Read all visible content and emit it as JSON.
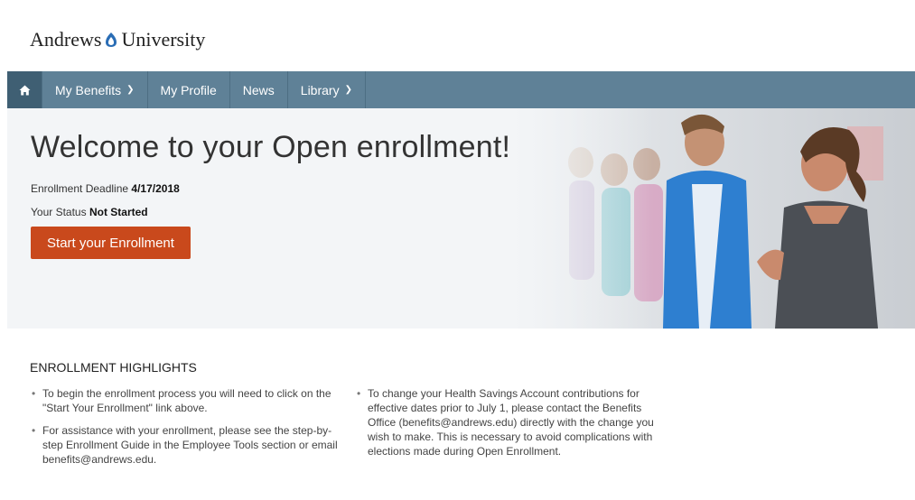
{
  "brand": {
    "name_left": "Andrews",
    "name_right": "University",
    "logo_icon": "flame-icon",
    "accent": "#2a6db5"
  },
  "nav": {
    "home_icon": "home-icon",
    "items": [
      {
        "label": "My Benefits",
        "dropdown": true
      },
      {
        "label": "My Profile",
        "dropdown": false
      },
      {
        "label": "News",
        "dropdown": false
      },
      {
        "label": "Library",
        "dropdown": true
      }
    ],
    "bar_color": "#5f8197",
    "active_color": "#3f5f73"
  },
  "hero": {
    "title": "Welcome to your Open enrollment!",
    "deadline_label": "Enrollment Deadline",
    "deadline_value": "4/17/2018",
    "status_label": "Your Status",
    "status_value": "Not Started",
    "cta_label": "Start your Enrollment",
    "cta_color": "#c9491c"
  },
  "highlights": {
    "title": "ENROLLMENT HIGHLIGHTS",
    "left": [
      "To begin the enrollment process you will need to click on the \"Start Your Enrollment\" link above.",
      "For assistance with your enrollment, please see the step-by-step Enrollment Guide in the Employee Tools section or email benefits@andrews.edu."
    ],
    "right": [
      "To change your Health Savings Account contributions for effective dates prior to July 1, please contact the Benefits Office (benefits@andrews.edu) directly with the change you wish to make. This is necessary to avoid complications with elections made during Open Enrollment."
    ]
  }
}
